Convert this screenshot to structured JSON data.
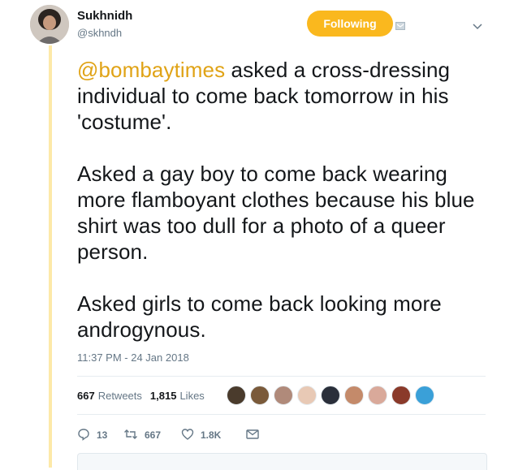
{
  "user": {
    "name": "Sukhnidh",
    "handle": "@skhndh"
  },
  "header": {
    "follow_label": "Following",
    "muted_icon": "muted-icon",
    "caret_icon": "chevron-down-icon"
  },
  "tweet": {
    "mention": "@bombaytimes",
    "line1_rest": " asked a cross-dressing individual to come back tomorrow in his 'costume'.",
    "paragraph2": "Asked a gay boy to come back wearing more flamboyant clothes because his blue shirt was too dull for a photo of a queer person.",
    "paragraph3": "Asked girls to come back looking more androgynous.",
    "timestamp": "11:37 PM - 24 Jan 2018"
  },
  "stats": {
    "retweets_count": "667",
    "retweets_label": "Retweets",
    "likes_count": "1,815",
    "likes_label": "Likes"
  },
  "actions": {
    "reply_count": "13",
    "retweet_count": "667",
    "like_count": "1.8K"
  },
  "colors": {
    "accent": "#fab81e",
    "mention": "#e0a316",
    "thread_line": "#fde9a8",
    "muted_text": "#657786"
  }
}
